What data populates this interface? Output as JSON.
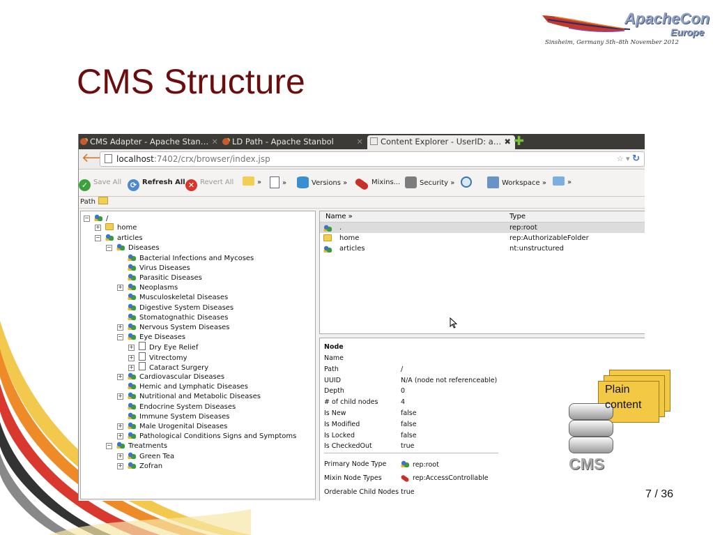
{
  "slide": {
    "title": "CMS Structure",
    "page_number": "7 / 36",
    "logo": {
      "line1": "ApacheCon",
      "line2": "Europe",
      "tagline": "Sinsheim, Germany 5th–8th November 2012"
    }
  },
  "browser": {
    "tabs": [
      {
        "label": "CMS Adapter - Apache Stan…",
        "active": false
      },
      {
        "label": "LD Path - Apache Stanbol",
        "active": false
      },
      {
        "label": "Content Explorer - UserID: a…",
        "active": true
      }
    ],
    "url": {
      "host": "localhost",
      "rest": ":7402/crx/browser/index.jsp"
    },
    "toolbar": {
      "save_all": "Save All",
      "refresh_all": "Refresh All",
      "revert_all": "Revert All",
      "chev": "»",
      "versions": "Versions »",
      "mixins": "Mixins...",
      "security": "Security »",
      "workspace": "Workspace »"
    },
    "path_label": "Path"
  },
  "tree": {
    "root": "/",
    "nodes": [
      {
        "label": "home",
        "icon": "folder-icon",
        "toggle": "+"
      },
      {
        "label": "articles",
        "icon": "node-icon",
        "toggle": "−"
      },
      {
        "label": "Diseases",
        "icon": "node-icon",
        "toggle": "−"
      },
      {
        "label": "Bacterial Infections and Mycoses",
        "icon": "node-icon",
        "toggle": ""
      },
      {
        "label": "Virus Diseases",
        "icon": "node-icon",
        "toggle": ""
      },
      {
        "label": "Parasitic Diseases",
        "icon": "node-icon",
        "toggle": ""
      },
      {
        "label": "Neoplasms",
        "icon": "node-icon",
        "toggle": "+"
      },
      {
        "label": "Musculoskeletal Diseases",
        "icon": "node-icon",
        "toggle": ""
      },
      {
        "label": "Digestive System Diseases",
        "icon": "node-icon",
        "toggle": ""
      },
      {
        "label": "Stomatognathic Diseases",
        "icon": "node-icon",
        "toggle": ""
      },
      {
        "label": "Nervous System Diseases",
        "icon": "node-icon",
        "toggle": "+"
      },
      {
        "label": "Eye Diseases",
        "icon": "node-icon",
        "toggle": "−"
      },
      {
        "label": "Dry Eye Relief",
        "icon": "file-icon",
        "toggle": "+"
      },
      {
        "label": "Vitrectomy",
        "icon": "file-icon",
        "toggle": "+"
      },
      {
        "label": "Cataract Surgery",
        "icon": "file-icon",
        "toggle": "+"
      },
      {
        "label": "Cardiovascular Diseases",
        "icon": "node-icon",
        "toggle": "+"
      },
      {
        "label": "Hemic and Lymphatic Diseases",
        "icon": "node-icon",
        "toggle": ""
      },
      {
        "label": "Nutritional and Metabolic Diseases",
        "icon": "node-icon",
        "toggle": "+"
      },
      {
        "label": "Endocrine System Diseases",
        "icon": "node-icon",
        "toggle": ""
      },
      {
        "label": "Immune System Diseases",
        "icon": "node-icon",
        "toggle": ""
      },
      {
        "label": "Male Urogenital Diseases",
        "icon": "node-icon",
        "toggle": "+"
      },
      {
        "label": "Pathological Conditions Signs and Symptoms",
        "icon": "node-icon",
        "toggle": "+"
      },
      {
        "label": "Treatments",
        "icon": "node-icon",
        "toggle": "−"
      },
      {
        "label": "Green Tea",
        "icon": "node-icon",
        "toggle": "+"
      },
      {
        "label": "Zofran",
        "icon": "node-icon",
        "toggle": "+"
      }
    ]
  },
  "list": {
    "headers": {
      "name": "Name  »",
      "type": "Type"
    },
    "rows": [
      {
        "name": ".",
        "type": "rep:root",
        "icon": "node-icon"
      },
      {
        "name": "home",
        "type": "rep:AuthorizableFolder",
        "icon": "folder-icon"
      },
      {
        "name": "articles",
        "type": "nt:unstructured",
        "icon": "node-icon"
      }
    ]
  },
  "properties": {
    "heading": "Node",
    "rows": [
      {
        "key": "Name",
        "value": ""
      },
      {
        "key": "Path",
        "value": "/"
      },
      {
        "key": "UUID",
        "value": "N/A (node not referenceable)"
      },
      {
        "key": "Depth",
        "value": "0"
      },
      {
        "key": "# of child nodes",
        "value": "4"
      },
      {
        "key": "Is New",
        "value": "false"
      },
      {
        "key": "Is Modified",
        "value": "false"
      },
      {
        "key": "Is Locked",
        "value": "false"
      },
      {
        "key": "Is CheckedOut",
        "value": "true"
      }
    ],
    "primary_type_key": "Primary Node Type",
    "primary_type_value": "rep:root",
    "mixin_key": "Mixin Node Types",
    "mixin_value": "rep:AccessControllable",
    "orderable": "Orderable Child Nodes true"
  },
  "cms_graphic": {
    "sheet_label_1": "Plain",
    "sheet_label_2": "content",
    "db_label": "CMS"
  },
  "colors": {
    "title": "#6b0d0d",
    "stripe_yellow": "#f2c94c",
    "stripe_red": "#d8382d",
    "stripe_orange": "#ef8a28",
    "stripe_gray": "#888888"
  }
}
